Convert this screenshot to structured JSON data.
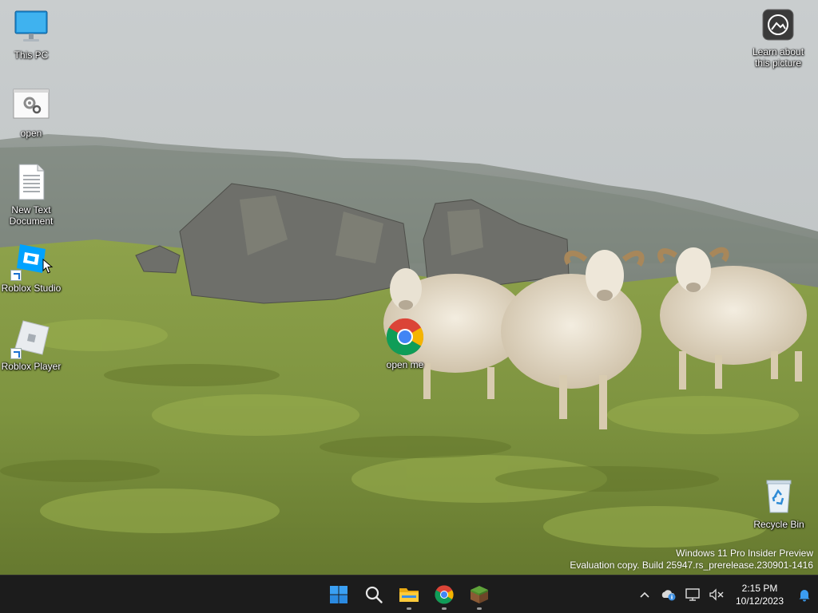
{
  "desktop": {
    "icons": [
      {
        "label": "This PC",
        "icon": "monitor-icon"
      },
      {
        "label": "open",
        "icon": "settings-file-icon"
      },
      {
        "label": "New Text\nDocument",
        "icon": "text-document-icon"
      },
      {
        "label": "Roblox Studio",
        "icon": "roblox-studio-icon"
      },
      {
        "label": "Roblox Player",
        "icon": "roblox-player-icon"
      },
      {
        "label": "open me",
        "icon": "chrome-icon"
      },
      {
        "label": "Learn about\nthis picture",
        "icon": "camera-icon"
      },
      {
        "label": "Recycle Bin",
        "icon": "recycle-bin-icon"
      }
    ]
  },
  "watermark": {
    "line1": "Windows 11 Pro Insider Preview",
    "line2": "Evaluation copy. Build 25947.rs_prerelease.230901-1416"
  },
  "taskbar": {
    "apps": [
      {
        "name": "Start",
        "icon": "windows-logo-icon"
      },
      {
        "name": "Search",
        "icon": "search-icon"
      },
      {
        "name": "File Explorer",
        "icon": "folder-icon",
        "running": true
      },
      {
        "name": "Google Chrome",
        "icon": "chrome-icon",
        "running": true
      },
      {
        "name": "Minecraft",
        "icon": "grass-block-icon",
        "running": true
      }
    ],
    "tray": {
      "overflow_icon": "chevron-up-icon",
      "onedrive_icon": "cloud-info-icon",
      "network_icon": "network-icon",
      "volume_icon": "volume-muted-icon",
      "notification_icon": "bell-icon"
    },
    "clock": {
      "time": "2:15 PM",
      "date": "10/12/2023"
    }
  },
  "colors": {
    "taskbar": "#1c1c1c",
    "accent": "#0078d4",
    "text": "#ffffff"
  }
}
